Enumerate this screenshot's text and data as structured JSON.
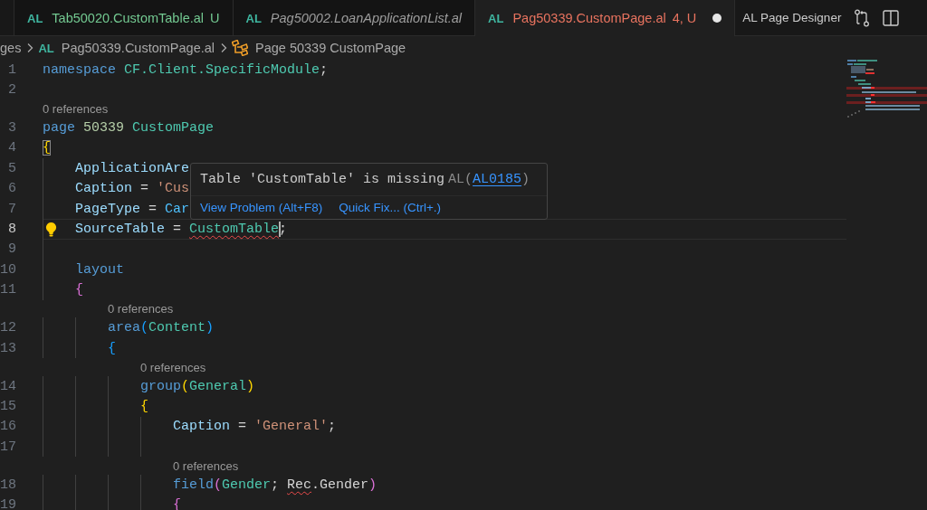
{
  "tabs": [
    {
      "badge": "AL",
      "label": "Tab50020.CustomTable.al",
      "status": "U",
      "color": "#73c991",
      "selected": false,
      "preview": false,
      "dirty": false
    },
    {
      "badge": "AL",
      "label": "Pag50002.LoanApplicationList.al",
      "color": "#9d9d9d",
      "selected": false,
      "preview": true,
      "dirty": false
    },
    {
      "badge": "AL",
      "label": "Pag50339.CustomPage.al",
      "status": "4, U",
      "color": "#e8735f",
      "selected": true,
      "preview": false,
      "dirty": true
    }
  ],
  "editor_actions": {
    "label": "AL Page Designer"
  },
  "breadcrumbs": [
    {
      "kind": "folder",
      "label": "ges"
    },
    {
      "kind": "file",
      "badge": "AL",
      "label": "Pag50339.CustomPage.al"
    },
    {
      "kind": "symbol",
      "label": "Page 50339 CustomPage"
    }
  ],
  "code": [
    {
      "number": "1",
      "tokens": [
        {
          "text": "namespace ",
          "kind": "keyword"
        },
        {
          "text": "CF.Client.SpecificModule",
          "kind": "type"
        },
        {
          "text": ";",
          "kind": "plain"
        }
      ]
    },
    {
      "number": "2"
    },
    {
      "number": "3",
      "lens": "0 references",
      "tokens": [
        {
          "text": "page ",
          "kind": "keyword"
        },
        {
          "text": "50339 ",
          "kind": "number"
        },
        {
          "text": "CustomPage",
          "kind": "type"
        }
      ]
    },
    {
      "number": "4",
      "tokens": [
        {
          "text": "{",
          "kind": "bracket1",
          "matched": true
        }
      ],
      "children": [
        {
          "number": "5",
          "tokens": [
            {
              "text": "ApplicationAre",
              "kind": "property"
            }
          ]
        },
        {
          "number": "6",
          "tokens": [
            {
              "text": "Caption",
              "kind": "property"
            },
            {
              "text": " = ",
              "kind": "plain"
            },
            {
              "text": "'Cus",
              "kind": "string"
            }
          ]
        },
        {
          "number": "7",
          "tokens": [
            {
              "text": "PageType",
              "kind": "property"
            },
            {
              "text": " = ",
              "kind": "plain"
            },
            {
              "text": "Car",
              "kind": "enum"
            }
          ]
        },
        {
          "number": "8",
          "current": true,
          "lightbulb": true,
          "tokens": [
            {
              "text": "SourceTable",
              "kind": "property"
            },
            {
              "text": " = ",
              "kind": "plain"
            },
            {
              "text": "CustomTable",
              "kind": "type",
              "error": true,
              "cursor": true
            },
            {
              "text": ";",
              "kind": "plain"
            }
          ]
        },
        {
          "number": "9"
        },
        {
          "number": "10",
          "tokens": [
            {
              "text": "layout",
              "kind": "keyword"
            }
          ]
        },
        {
          "number": "11",
          "tokens": [
            {
              "text": "{",
              "kind": "bracket2"
            }
          ],
          "children": [
            {
              "number": "12",
              "lens": "0 references",
              "tokens": [
                {
                  "text": "area",
                  "kind": "keyword"
                },
                {
                  "text": "(",
                  "kind": "bracket3"
                },
                {
                  "text": "Content",
                  "kind": "type"
                },
                {
                  "text": ")",
                  "kind": "bracket3"
                }
              ]
            },
            {
              "number": "13",
              "tokens": [
                {
                  "text": "{",
                  "kind": "bracket3"
                }
              ],
              "children": [
                {
                  "number": "14",
                  "lens": "0 references",
                  "tokens": [
                    {
                      "text": "group",
                      "kind": "keyword"
                    },
                    {
                      "text": "(",
                      "kind": "bracket1"
                    },
                    {
                      "text": "General",
                      "kind": "type"
                    },
                    {
                      "text": ")",
                      "kind": "bracket1"
                    }
                  ]
                },
                {
                  "number": "15",
                  "tokens": [
                    {
                      "text": "{",
                      "kind": "bracket1"
                    }
                  ],
                  "children": [
                    {
                      "number": "16",
                      "tokens": [
                        {
                          "text": "Caption",
                          "kind": "property"
                        },
                        {
                          "text": " = ",
                          "kind": "plain"
                        },
                        {
                          "text": "'General'",
                          "kind": "string"
                        },
                        {
                          "text": ";",
                          "kind": "plain"
                        }
                      ]
                    },
                    {
                      "number": "17"
                    },
                    {
                      "number": "18",
                      "lens": "0 references",
                      "tokens": [
                        {
                          "text": "field",
                          "kind": "keyword"
                        },
                        {
                          "text": "(",
                          "kind": "bracket2"
                        },
                        {
                          "text": "Gender",
                          "kind": "type"
                        },
                        {
                          "text": "; ",
                          "kind": "plain"
                        },
                        {
                          "text": "Rec",
                          "kind": "plain",
                          "error": true
                        },
                        {
                          "text": ".Gender",
                          "kind": "plain"
                        },
                        {
                          "text": ")",
                          "kind": "bracket2"
                        }
                      ]
                    },
                    {
                      "number": "19",
                      "tokens": [
                        {
                          "text": "{",
                          "kind": "bracket2"
                        }
                      ]
                    }
                  ]
                }
              ]
            }
          ]
        }
      ]
    }
  ],
  "hover": {
    "message": "Table 'CustomTable' is missing",
    "source": "AL(",
    "code": "AL0185",
    "source_end": ")",
    "actions": [
      "View Problem (Alt+F8)",
      "Quick Fix... (Ctrl+.)"
    ]
  }
}
